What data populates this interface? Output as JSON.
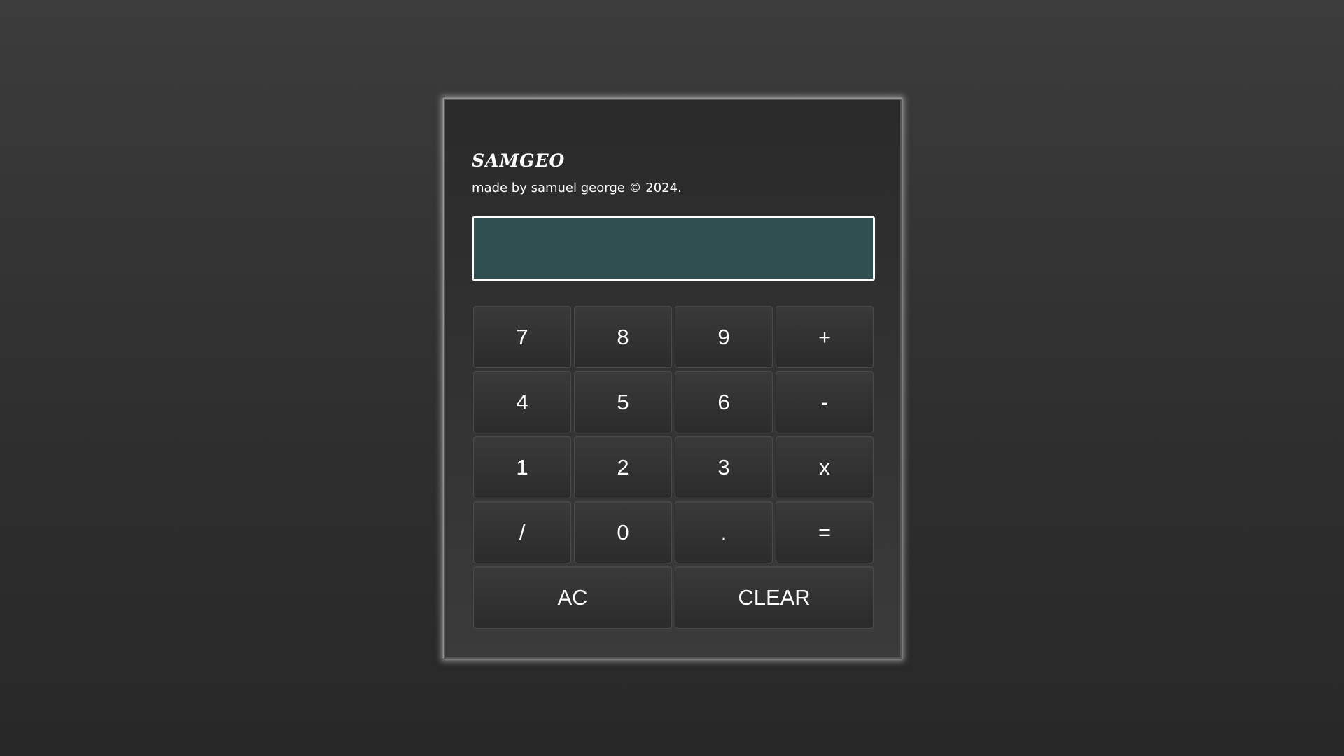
{
  "app": {
    "brand": "SAMGEO",
    "credit": "made by samuel george © 2024."
  },
  "display": {
    "value": ""
  },
  "keys": [
    {
      "label": "7",
      "name": "key-7"
    },
    {
      "label": "8",
      "name": "key-8"
    },
    {
      "label": "9",
      "name": "key-9"
    },
    {
      "label": "+",
      "name": "key-plus"
    },
    {
      "label": "4",
      "name": "key-4"
    },
    {
      "label": "5",
      "name": "key-5"
    },
    {
      "label": "6",
      "name": "key-6"
    },
    {
      "label": "-",
      "name": "key-minus"
    },
    {
      "label": "1",
      "name": "key-1"
    },
    {
      "label": "2",
      "name": "key-2"
    },
    {
      "label": "3",
      "name": "key-3"
    },
    {
      "label": "x",
      "name": "key-multiply"
    },
    {
      "label": "/",
      "name": "key-divide"
    },
    {
      "label": "0",
      "name": "key-0"
    },
    {
      "label": ".",
      "name": "key-decimal"
    },
    {
      "label": "=",
      "name": "key-equals"
    },
    {
      "label": "AC",
      "name": "key-ac"
    },
    {
      "label": "CLEAR",
      "name": "key-clear"
    }
  ],
  "colors": {
    "display_background": "#2f5050",
    "display_border": "#ffffff",
    "page_background": "#333333",
    "key_background": "#303030"
  }
}
